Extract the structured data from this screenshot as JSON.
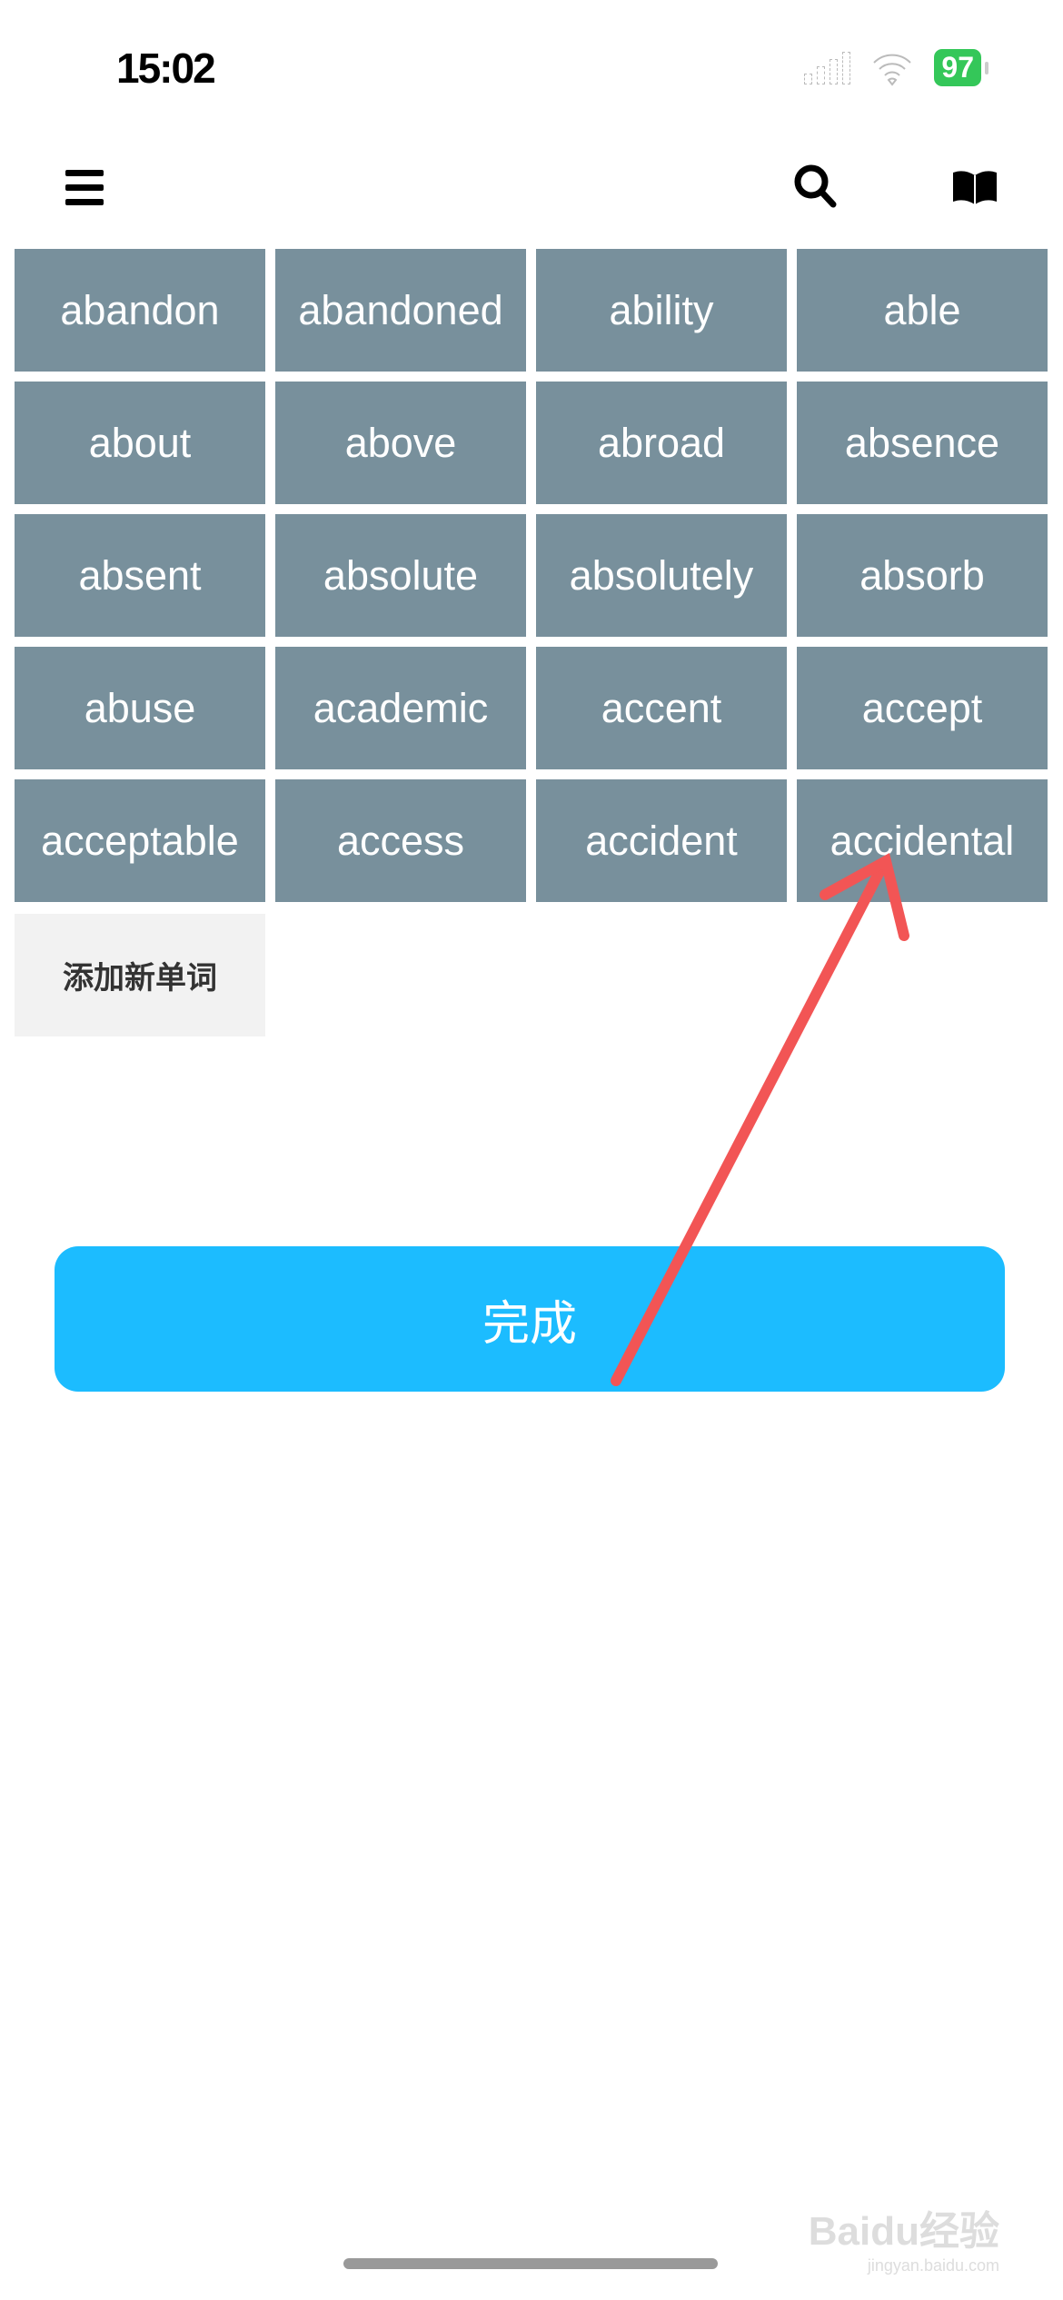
{
  "status_bar": {
    "time": "15:02",
    "battery": "97",
    "colors": {
      "battery": "#34c759"
    }
  },
  "header": {
    "icons": [
      "menu-icon",
      "search-icon",
      "book-icon"
    ]
  },
  "words": [
    "abandon",
    "abandoned",
    "ability",
    "able",
    "about",
    "above",
    "abroad",
    "absence",
    "absent",
    "absolute",
    "absolutely",
    "absorb",
    "abuse",
    "academic",
    "accent",
    "accept",
    "acceptable",
    "access",
    "accident",
    "accidental"
  ],
  "add_word_label": "添加新单词",
  "done_label": "完成",
  "watermark": {
    "brand": "Baidu经验",
    "url": "jingyan.baidu.com"
  },
  "colors": {
    "tile": "#78909c",
    "done_button": "#1cbcff",
    "annotation_arrow": "#f25555"
  }
}
